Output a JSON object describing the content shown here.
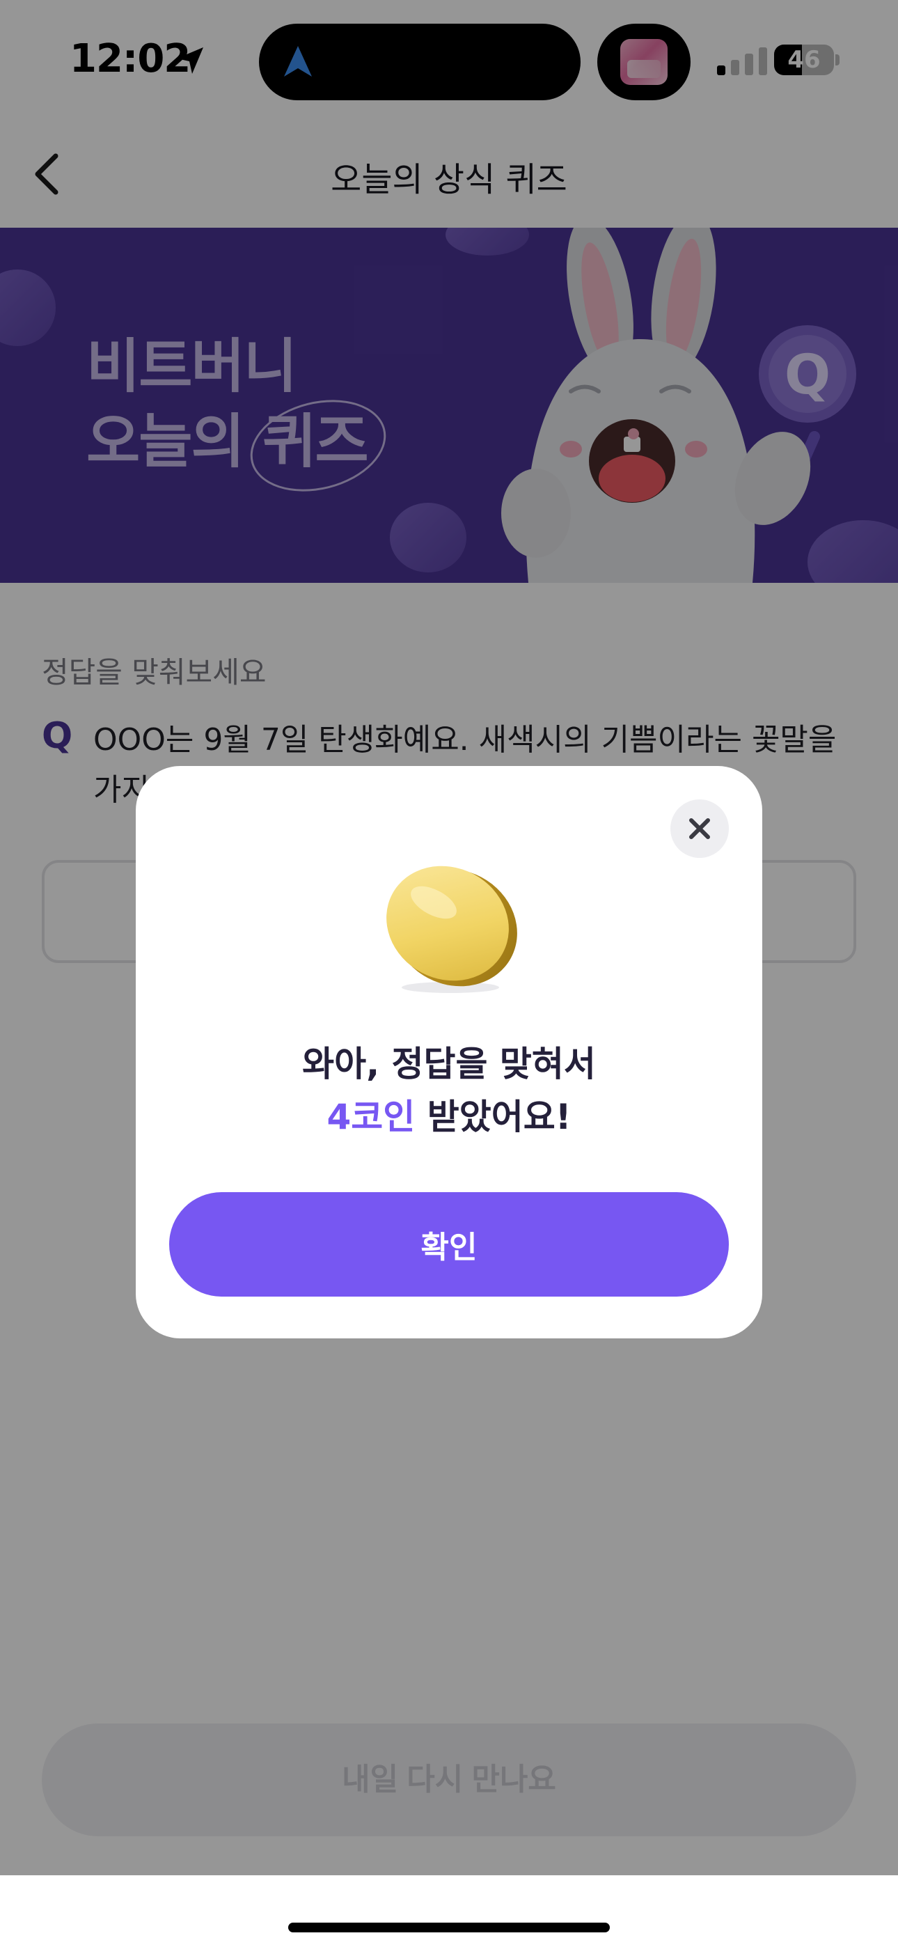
{
  "status_bar": {
    "time": "12:02",
    "battery_level": "46",
    "battery_fraction": 0.46,
    "icons": [
      "location-arrow-icon",
      "navigation-icon",
      "app-thumbnail-icon",
      "signal-icon",
      "battery-icon"
    ]
  },
  "header": {
    "title": "오늘의 상식 퀴즈",
    "back_icon": "chevron-left-icon"
  },
  "banner": {
    "line1": "비트버니",
    "line2": "오늘의 퀴즈",
    "mascot_icon": "bunny-mascot",
    "sign_letter": "Q",
    "background_color": "#4a3495"
  },
  "quiz": {
    "prompt": "정답을 맞춰보세요",
    "q_mark": "Q",
    "question_visible": "OOO는 9월 7일 탄생화예요. 새색시의 기쁨이라는 꽃말을 가지"
  },
  "footer_button": {
    "label": "내일 다시 만나요"
  },
  "modal": {
    "close_icon": "close-icon",
    "coin_icon": "gold-coin-icon",
    "message_line1": "와아, 정답을 맞혀서",
    "message_accent": "4코인",
    "message_rest": " 받았어요!",
    "confirm_label": "확인",
    "accent_color": "#7757f2"
  }
}
